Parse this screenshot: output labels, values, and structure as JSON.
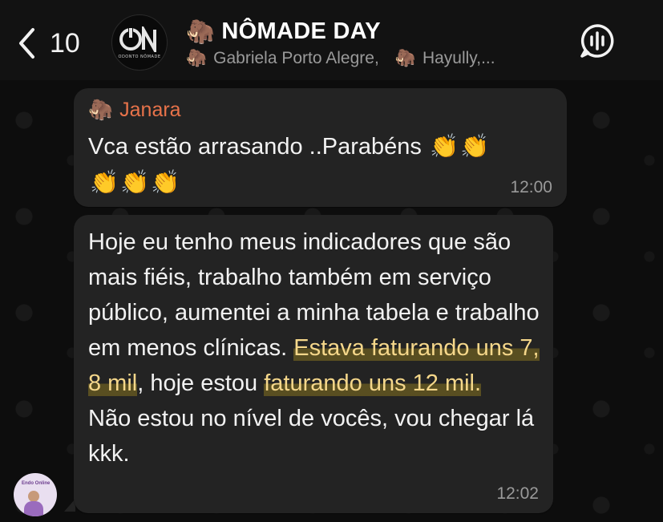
{
  "header": {
    "back_count": "10",
    "group_title": "NÔMADE DAY",
    "title_emoji": "🦣",
    "avatar_logo_text": "ON",
    "avatar_caption": "ODONTO NÔMADE",
    "members": [
      {
        "emoji": "🦣",
        "name": "Gabriela Porto Alegre,"
      },
      {
        "emoji": "🦣",
        "name": "Hayully,..."
      }
    ],
    "icons": [
      "chevron-left-icon",
      "voice-chat-icon"
    ]
  },
  "messages": [
    {
      "sender_emoji": "🦣",
      "sender": "Janara",
      "sender_color": "#e8734a",
      "text": "Vca estão arrasando ..Parabéns",
      "claps": [
        "👏",
        "👏",
        "👏",
        "👏",
        "👏"
      ],
      "time": "12:00"
    },
    {
      "text_before": "Hoje eu tenho meus indicadores que são mais fiéis, trabalho também em serviço público, aumentei a minha tabela e trabalho em menos clínicas. ",
      "highlight_1": "Estava faturando uns 7, 8 mil",
      "text_middle": ", hoje estou ",
      "highlight_2": "faturando uns 12 mil.",
      "text_after": "\nNão estou no nível de vocês, vou chegar lá kkk.",
      "time": "12:02",
      "highlight_color": "#f5d78a"
    }
  ],
  "user_avatar_text": "Endo Online"
}
